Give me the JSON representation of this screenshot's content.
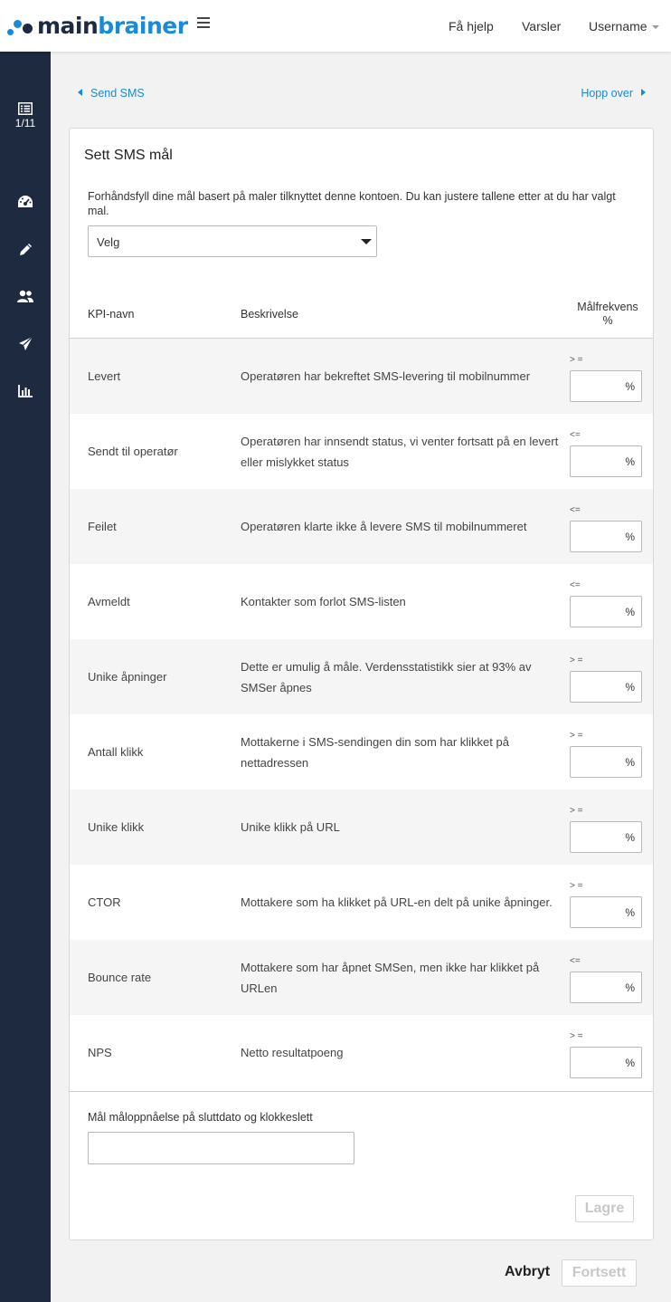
{
  "header": {
    "logo_main": "main",
    "logo_brainer": "brainer",
    "help": "Få hjelp",
    "notifications": "Varsler",
    "username": "Username"
  },
  "sidebar": {
    "step": "1/11",
    "icons": [
      "list-icon",
      "dashboard-icon",
      "pencil-icon",
      "users-icon",
      "send-icon",
      "chart-icon"
    ]
  },
  "nav": {
    "back": "Send SMS",
    "skip": "Hopp over"
  },
  "card": {
    "title": "Sett SMS mål",
    "intro": "Forhåndsfyll dine mål basert på maler tilknyttet denne kontoen. Du kan justere tallene etter at du har valgt mal.",
    "select_value": "Velg",
    "columns": {
      "kpi": "KPI-navn",
      "description": "Beskrivelse",
      "frequency": "Målfrekvens",
      "frequency_unit": "%"
    },
    "rows": [
      {
        "kpi": "Levert",
        "description": "Operatøren har bekreftet SMS-levering til mobilnummer",
        "operator": "> =",
        "unit": "%"
      },
      {
        "kpi": "Sendt til operatør",
        "description": "Operatøren har innsendt status, vi venter fortsatt på en levert eller mislykket status",
        "operator": "<=",
        "unit": "%"
      },
      {
        "kpi": "Feilet",
        "description": "Operatøren klarte ikke å levere SMS til mobilnummeret",
        "operator": "<=",
        "unit": "%"
      },
      {
        "kpi": "Avmeldt",
        "description": "Kontakter som forlot SMS-listen",
        "operator": "<=",
        "unit": "%"
      },
      {
        "kpi": "Unike åpninger",
        "description": "Dette er umulig å måle. Verdensstatistikk sier at 93% av SMSer åpnes",
        "operator": "> =",
        "unit": "%"
      },
      {
        "kpi": "Antall klikk",
        "description": "Mottakerne i SMS-sendingen din som har klikket på nettadressen",
        "operator": "> =",
        "unit": "%"
      },
      {
        "kpi": "Unike klikk",
        "description": "Unike klikk på URL",
        "operator": "> =",
        "unit": "%"
      },
      {
        "kpi": "CTOR",
        "description": "Mottakere som ha klikket på URL-en delt på unike åpninger.",
        "operator": "> =",
        "unit": "%"
      },
      {
        "kpi": "Bounce rate",
        "description": "Mottakere som har åpnet SMSen, men ikke har klikket på URLen",
        "operator": "<=",
        "unit": "%"
      },
      {
        "kpi": "NPS",
        "description": "Netto resultatpoeng",
        "operator": "> =",
        "unit": "%"
      }
    ],
    "date_label": "Mål måloppnåelse på sluttdato og klokkeslett",
    "save": "Lagre"
  },
  "footer": {
    "cancel": "Avbryt",
    "continue": "Fortsett"
  },
  "colors": {
    "sidebar": "#1d2a3f",
    "accent": "#1a8ad4",
    "stripe": "#f5f5f5"
  }
}
